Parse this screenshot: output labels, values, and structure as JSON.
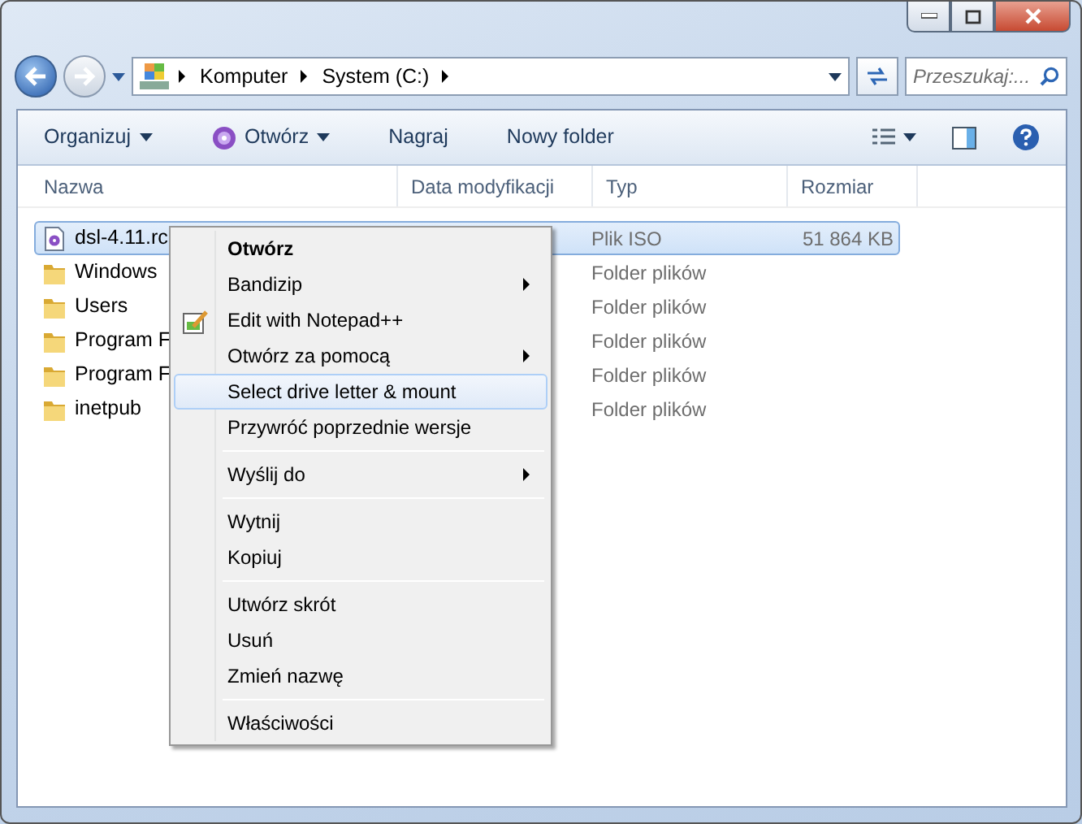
{
  "breadcrumb": [
    "Komputer",
    "System (C:)"
  ],
  "search": {
    "placeholder": "Przeszukaj:..."
  },
  "toolbar": [
    {
      "label": "Organizuj",
      "dropdown": true
    },
    {
      "label": "Otwórz",
      "dropdown": true
    },
    {
      "label": "Nagraj",
      "dropdown": false
    },
    {
      "label": "Nowy folder",
      "dropdown": false
    }
  ],
  "columns": [
    "Nazwa",
    "Data modyfikacji",
    "Typ",
    "Rozmiar"
  ],
  "rows": [
    {
      "kind": "file",
      "name": "dsl-4.11.rc",
      "type": "Plik ISO",
      "size": "51 864 KB",
      "selected": true
    },
    {
      "kind": "folder",
      "name": "Windows",
      "type": "Folder plików",
      "size": "",
      "selected": false
    },
    {
      "kind": "folder",
      "name": "Users",
      "type": "Folder plików",
      "size": "",
      "selected": false
    },
    {
      "kind": "folder",
      "name": "Program F",
      "type": "Folder plików",
      "size": "",
      "selected": false
    },
    {
      "kind": "folder",
      "name": "Program F",
      "type": "Folder plików",
      "size": "",
      "selected": false
    },
    {
      "kind": "folder",
      "name": "inetpub",
      "type": "Folder plików",
      "size": "",
      "selected": false
    }
  ],
  "context_menu": [
    {
      "kind": "item",
      "label": "Otwórz",
      "bold": true,
      "submenu": false,
      "selected": false
    },
    {
      "kind": "item",
      "label": "Bandizip",
      "bold": false,
      "submenu": true,
      "selected": false
    },
    {
      "kind": "item",
      "label": "Edit with Notepad++",
      "bold": false,
      "submenu": false,
      "selected": false
    },
    {
      "kind": "item",
      "label": "Otwórz za pomocą",
      "bold": false,
      "submenu": true,
      "selected": false
    },
    {
      "kind": "item",
      "label": "Select drive letter & mount",
      "bold": false,
      "submenu": false,
      "selected": true
    },
    {
      "kind": "item",
      "label": "Przywróć poprzednie wersje",
      "bold": false,
      "submenu": false,
      "selected": false
    },
    {
      "kind": "separator"
    },
    {
      "kind": "item",
      "label": "Wyślij do",
      "bold": false,
      "submenu": true,
      "selected": false
    },
    {
      "kind": "separator"
    },
    {
      "kind": "item",
      "label": "Wytnij",
      "bold": false,
      "submenu": false,
      "selected": false
    },
    {
      "kind": "item",
      "label": "Kopiuj",
      "bold": false,
      "submenu": false,
      "selected": false
    },
    {
      "kind": "separator"
    },
    {
      "kind": "item",
      "label": "Utwórz skrót",
      "bold": false,
      "submenu": false,
      "selected": false
    },
    {
      "kind": "item",
      "label": "Usuń",
      "bold": false,
      "submenu": false,
      "selected": false
    },
    {
      "kind": "item",
      "label": "Zmień nazwę",
      "bold": false,
      "submenu": false,
      "selected": false
    },
    {
      "kind": "separator"
    },
    {
      "kind": "item",
      "label": "Właściwości",
      "bold": false,
      "submenu": false,
      "selected": false
    }
  ]
}
